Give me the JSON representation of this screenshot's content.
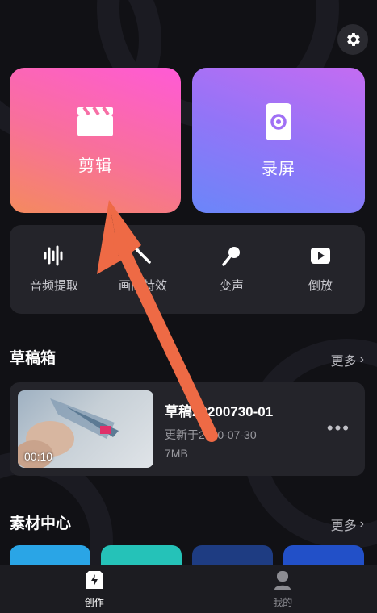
{
  "header": {
    "settings_icon": "gear-icon"
  },
  "cards": [
    {
      "label": "剪辑",
      "icon": "clapperboard-icon"
    },
    {
      "label": "录屏",
      "icon": "screen-record-icon"
    }
  ],
  "tools": [
    {
      "label": "音频提取",
      "icon": "waveform-icon"
    },
    {
      "label": "画面特效",
      "icon": "magic-wand-icon"
    },
    {
      "label": "变声",
      "icon": "microphone-icon"
    },
    {
      "label": "倒放",
      "icon": "play-icon"
    }
  ],
  "drafts": {
    "title": "草稿箱",
    "more": "更多",
    "items": [
      {
        "name": "草稿20200730-01",
        "updated": "更新于2020-07-30",
        "size": "7MB",
        "duration": "00:10"
      }
    ]
  },
  "materials": {
    "title": "素材中心",
    "more": "更多"
  },
  "nav": [
    {
      "label": "创作",
      "icon": "create-icon"
    },
    {
      "label": "我的",
      "icon": "profile-icon"
    }
  ],
  "colors": {
    "annotation_arrow": "#ee6a45",
    "background": "#111115"
  }
}
